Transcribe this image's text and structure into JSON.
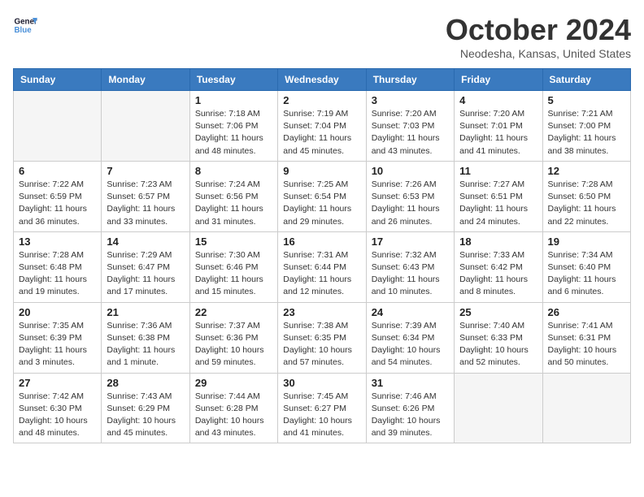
{
  "header": {
    "logo_line1": "General",
    "logo_line2": "Blue",
    "month_title": "October 2024",
    "location": "Neodesha, Kansas, United States"
  },
  "days_of_week": [
    "Sunday",
    "Monday",
    "Tuesday",
    "Wednesday",
    "Thursday",
    "Friday",
    "Saturday"
  ],
  "weeks": [
    [
      {
        "day": "",
        "info": ""
      },
      {
        "day": "",
        "info": ""
      },
      {
        "day": "1",
        "info": "Sunrise: 7:18 AM\nSunset: 7:06 PM\nDaylight: 11 hours and 48 minutes."
      },
      {
        "day": "2",
        "info": "Sunrise: 7:19 AM\nSunset: 7:04 PM\nDaylight: 11 hours and 45 minutes."
      },
      {
        "day": "3",
        "info": "Sunrise: 7:20 AM\nSunset: 7:03 PM\nDaylight: 11 hours and 43 minutes."
      },
      {
        "day": "4",
        "info": "Sunrise: 7:20 AM\nSunset: 7:01 PM\nDaylight: 11 hours and 41 minutes."
      },
      {
        "day": "5",
        "info": "Sunrise: 7:21 AM\nSunset: 7:00 PM\nDaylight: 11 hours and 38 minutes."
      }
    ],
    [
      {
        "day": "6",
        "info": "Sunrise: 7:22 AM\nSunset: 6:59 PM\nDaylight: 11 hours and 36 minutes."
      },
      {
        "day": "7",
        "info": "Sunrise: 7:23 AM\nSunset: 6:57 PM\nDaylight: 11 hours and 33 minutes."
      },
      {
        "day": "8",
        "info": "Sunrise: 7:24 AM\nSunset: 6:56 PM\nDaylight: 11 hours and 31 minutes."
      },
      {
        "day": "9",
        "info": "Sunrise: 7:25 AM\nSunset: 6:54 PM\nDaylight: 11 hours and 29 minutes."
      },
      {
        "day": "10",
        "info": "Sunrise: 7:26 AM\nSunset: 6:53 PM\nDaylight: 11 hours and 26 minutes."
      },
      {
        "day": "11",
        "info": "Sunrise: 7:27 AM\nSunset: 6:51 PM\nDaylight: 11 hours and 24 minutes."
      },
      {
        "day": "12",
        "info": "Sunrise: 7:28 AM\nSunset: 6:50 PM\nDaylight: 11 hours and 22 minutes."
      }
    ],
    [
      {
        "day": "13",
        "info": "Sunrise: 7:28 AM\nSunset: 6:48 PM\nDaylight: 11 hours and 19 minutes."
      },
      {
        "day": "14",
        "info": "Sunrise: 7:29 AM\nSunset: 6:47 PM\nDaylight: 11 hours and 17 minutes."
      },
      {
        "day": "15",
        "info": "Sunrise: 7:30 AM\nSunset: 6:46 PM\nDaylight: 11 hours and 15 minutes."
      },
      {
        "day": "16",
        "info": "Sunrise: 7:31 AM\nSunset: 6:44 PM\nDaylight: 11 hours and 12 minutes."
      },
      {
        "day": "17",
        "info": "Sunrise: 7:32 AM\nSunset: 6:43 PM\nDaylight: 11 hours and 10 minutes."
      },
      {
        "day": "18",
        "info": "Sunrise: 7:33 AM\nSunset: 6:42 PM\nDaylight: 11 hours and 8 minutes."
      },
      {
        "day": "19",
        "info": "Sunrise: 7:34 AM\nSunset: 6:40 PM\nDaylight: 11 hours and 6 minutes."
      }
    ],
    [
      {
        "day": "20",
        "info": "Sunrise: 7:35 AM\nSunset: 6:39 PM\nDaylight: 11 hours and 3 minutes."
      },
      {
        "day": "21",
        "info": "Sunrise: 7:36 AM\nSunset: 6:38 PM\nDaylight: 11 hours and 1 minute."
      },
      {
        "day": "22",
        "info": "Sunrise: 7:37 AM\nSunset: 6:36 PM\nDaylight: 10 hours and 59 minutes."
      },
      {
        "day": "23",
        "info": "Sunrise: 7:38 AM\nSunset: 6:35 PM\nDaylight: 10 hours and 57 minutes."
      },
      {
        "day": "24",
        "info": "Sunrise: 7:39 AM\nSunset: 6:34 PM\nDaylight: 10 hours and 54 minutes."
      },
      {
        "day": "25",
        "info": "Sunrise: 7:40 AM\nSunset: 6:33 PM\nDaylight: 10 hours and 52 minutes."
      },
      {
        "day": "26",
        "info": "Sunrise: 7:41 AM\nSunset: 6:31 PM\nDaylight: 10 hours and 50 minutes."
      }
    ],
    [
      {
        "day": "27",
        "info": "Sunrise: 7:42 AM\nSunset: 6:30 PM\nDaylight: 10 hours and 48 minutes."
      },
      {
        "day": "28",
        "info": "Sunrise: 7:43 AM\nSunset: 6:29 PM\nDaylight: 10 hours and 45 minutes."
      },
      {
        "day": "29",
        "info": "Sunrise: 7:44 AM\nSunset: 6:28 PM\nDaylight: 10 hours and 43 minutes."
      },
      {
        "day": "30",
        "info": "Sunrise: 7:45 AM\nSunset: 6:27 PM\nDaylight: 10 hours and 41 minutes."
      },
      {
        "day": "31",
        "info": "Sunrise: 7:46 AM\nSunset: 6:26 PM\nDaylight: 10 hours and 39 minutes."
      },
      {
        "day": "",
        "info": ""
      },
      {
        "day": "",
        "info": ""
      }
    ]
  ]
}
